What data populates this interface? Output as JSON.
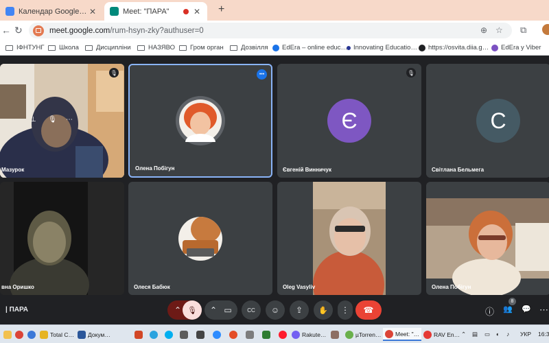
{
  "tabs": [
    {
      "title": "Календар Google - Графік по…",
      "close": "✕",
      "active": false,
      "favicon_color": "#4285f4"
    },
    {
      "title": "Meet: \"ПАРА\"",
      "close": "✕",
      "active": true,
      "favicon_color": "#00897b",
      "recording": true
    }
  ],
  "new_tab": "+",
  "toolbar": {
    "back": "←",
    "reload": "↻",
    "url_host": "meet.google.com",
    "url_path": "/rum-hsyn-zky?authuser=0",
    "zoom_icon": "⊕",
    "star_icon": "☆",
    "ext_icon": "⧉"
  },
  "bookmarks": [
    {
      "label": "ІФНТУНГ",
      "type": "folder"
    },
    {
      "label": "Школа",
      "type": "folder"
    },
    {
      "label": "Дисципліни",
      "type": "folder"
    },
    {
      "label": "НАЗЯВО",
      "type": "folder"
    },
    {
      "label": "Гром орган",
      "type": "folder"
    },
    {
      "label": "Дозвілля",
      "type": "folder"
    },
    {
      "label": "EdEra – online educ…",
      "type": "site",
      "color": "#1a73e8"
    },
    {
      "label": "Innovating Educatio…",
      "type": "site",
      "color": "#283593"
    },
    {
      "label": "https://osvita.diia.g…",
      "type": "site",
      "color": "#202124"
    },
    {
      "label": "EdEra у Viber",
      "type": "site",
      "color": "#7b51c2"
    }
  ],
  "participants": [
    {
      "name": "Мазурок",
      "kind": "video",
      "muted": true
    },
    {
      "name": "Олена Побігун",
      "kind": "photo",
      "muted": false,
      "more": "•••"
    },
    {
      "name": "Євгеній Винничук",
      "kind": "letter",
      "letter": "Є",
      "color": "#7e57c2",
      "muted": true
    },
    {
      "name": "Світлана Бельмега",
      "kind": "letter",
      "letter": "С",
      "color": "#455a64",
      "muted": false
    },
    {
      "name": "вна Оришко",
      "kind": "video",
      "muted": false
    },
    {
      "name": "Олеся Бабюк",
      "kind": "photo",
      "muted": false
    },
    {
      "name": "Oleg Vasyliv",
      "kind": "video",
      "muted": false
    },
    {
      "name": "Олена Побігун",
      "kind": "video",
      "muted": false
    }
  ],
  "meeting": {
    "title": "ПАРА",
    "participant_count": "8"
  },
  "controls": {
    "chevron_up": "⌃",
    "mic_muted": "🎙",
    "camera": "▭",
    "captions": "CC",
    "emoji": "☺",
    "present": "⇪",
    "hand": "✋",
    "more": "⋮",
    "hangup": "☎",
    "info": "ⓘ",
    "people": "👥",
    "chat": "💬",
    "activities": "⋯"
  },
  "taskbar": {
    "items": [
      {
        "label": "Total C…",
        "color": "#e6b422"
      },
      {
        "label": "Докум…",
        "color": "#2b579a"
      },
      {
        "label": "Rakute…",
        "color": "#7360f2"
      },
      {
        "label": "µTorren…",
        "color": "#6ab04c"
      },
      {
        "label": "Meet: \"…",
        "color": "#00897b"
      },
      {
        "label": "RAV En…",
        "color": "#e53935"
      }
    ],
    "lang": "УКР",
    "time": "16:3"
  }
}
